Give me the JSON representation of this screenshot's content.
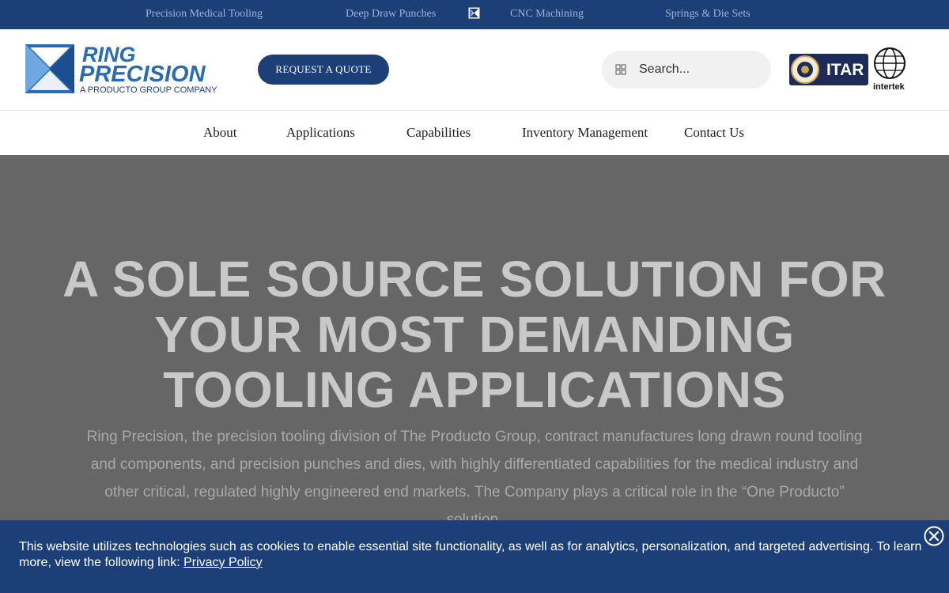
{
  "topbar": {
    "links": [
      "Precision Medical Tooling",
      "Deep Draw Punches",
      "CNC Machining",
      "Springs & Die Sets"
    ]
  },
  "header": {
    "logo_line1": "RING",
    "logo_line2": "PRECISION",
    "logo_tagline": "A PRODUCTO GROUP COMPANY",
    "quote_button": "REQUEST A QUOTE",
    "search_placeholder": "Search...",
    "itar_badge": "ITAR",
    "intertek_badge": "intertek"
  },
  "nav": {
    "items": [
      "About",
      "Applications",
      "Capabilities",
      "Inventory Management",
      "Contact Us"
    ]
  },
  "hero": {
    "headline_line1": "A SOLE SOURCE SOLUTION FOR",
    "headline_line2": "YOUR MOST DEMANDING",
    "headline_line3": "TOOLING APPLICATIONS",
    "description": "Ring Precision, the precision tooling division of The Producto Group, contract manufactures long drawn round tooling and components, and precision punches and dies, with highly differentiated capabilities for the medical industry and other critical, regulated highly engineered end markets. The Company plays a critical role in the “One Producto” solution."
  },
  "cookie": {
    "message": "This website utilizes technologies such as cookies to enable essential site functionality, as well as for analytics, personalization, and targeted advertising. To learn more, view the following link: ",
    "link_text": "Privacy Policy"
  },
  "colors": {
    "brand_navy": "#1d3f78",
    "logo_blue": "#2a6bb5",
    "hero_overlay": "#666666"
  }
}
